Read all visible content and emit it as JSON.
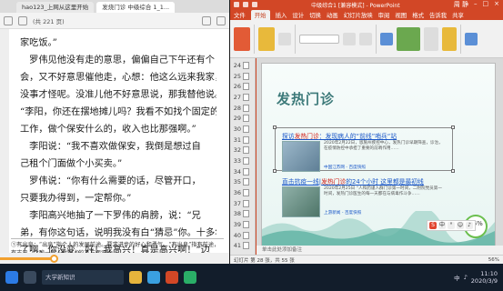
{
  "reader": {
    "tabs": [
      "hao123_上网从这里开始",
      "发烧门诊 中级综合 1_1..."
    ],
    "page_indicator": "(共 221 页)",
    "paragraphs": [
      "家吃饭。”",
      "　罗伟见他没有走的意思，偏偏自己下午还有个",
      "会，又不好意思催他走，心想：他这么远来我家，",
      "没事才怪呢。没准儿他不好意思说，那我替他说。",
      "“李阳，你还在摆地摊儿吗？我看不如找个固定的",
      "工作，做个保安什么的，收入也比那强啊。”",
      "　李阳说：“我不喜欢做保安，我倒是想过自",
      "己租个门面做个小买卖。”",
      "　罗伟说：“你有什么需要的话，尽管开口，",
      "只要我办得到，一定帮你。”",
      "　李阳高兴地抽了一下罗伟的肩膀，说：“兄",
      "弟，有你这句话，说明我没有白“猜忌”你。十多年",
      "了啊，你没变。好！我高兴！真是高兴啊！”边"
    ],
    "footnote": "①有出息：“出息”指个人的发展前途。要求进步的好心和勇气。“有出息”指有前途，有志向，比喻一般人对别人的某方面评价。",
    "progress": 0.24
  },
  "ppt": {
    "window_title": "中级综合1 [兼容模式] - PowerPoint",
    "user": "周 静",
    "tabs": [
      "文件",
      "开始",
      "插入",
      "设计",
      "切换",
      "动画",
      "幻灯片放映",
      "审阅",
      "视图",
      "格式",
      "告诉我",
      "共享"
    ],
    "active_tab": "开始",
    "slide_numbers": [
      "24",
      "25",
      "26",
      "27",
      "28",
      "29",
      "30",
      "31",
      "32",
      "33",
      "34",
      "35",
      "36",
      "37",
      "38",
      "39",
      "40",
      "41"
    ],
    "slide": {
      "title": "发热门诊",
      "news": [
        {
          "title_prefix": "探访",
          "title_hl": "发热门诊",
          "title_rest": "：发现病人的“前线”哨兵“站",
          "text": "2020年2月22日，恩施州疾控中心，发热门诊早期筛查，诊治，在疫情防控中承担了重要的前哨作用……",
          "meta": "中国江苏网 - 百度快照"
        },
        {
          "title_prefix": "直击抗疫一线|",
          "title_hl": "发热门诊",
          "title_rest": "的24个小时 这里都是最初线",
          "text": "2020年2月25日 “人和药谨人群门诊第一时间，二附院党员第一时间，发热门诊医生的每一天都在与病毒作斗争……",
          "meta": "上游新闻 - 百度快照"
        }
      ]
    },
    "zoom_badge": "56%",
    "notes_placeholder": "单击此处添加备注",
    "status": {
      "slide_count": "幻灯片 第 28 张，共 55 张",
      "zoom": "56%"
    }
  },
  "taskbar": {
    "task_label": "大学新知识",
    "time": "11:10",
    "date": "2020/3/9",
    "lang": "中"
  },
  "colors": {
    "ppt_accent": "#d24726",
    "slide_title": "#3d7a7a",
    "link": "#1a57c8",
    "highlight": "#d0221b",
    "reader_progress": "#f2a02e"
  }
}
